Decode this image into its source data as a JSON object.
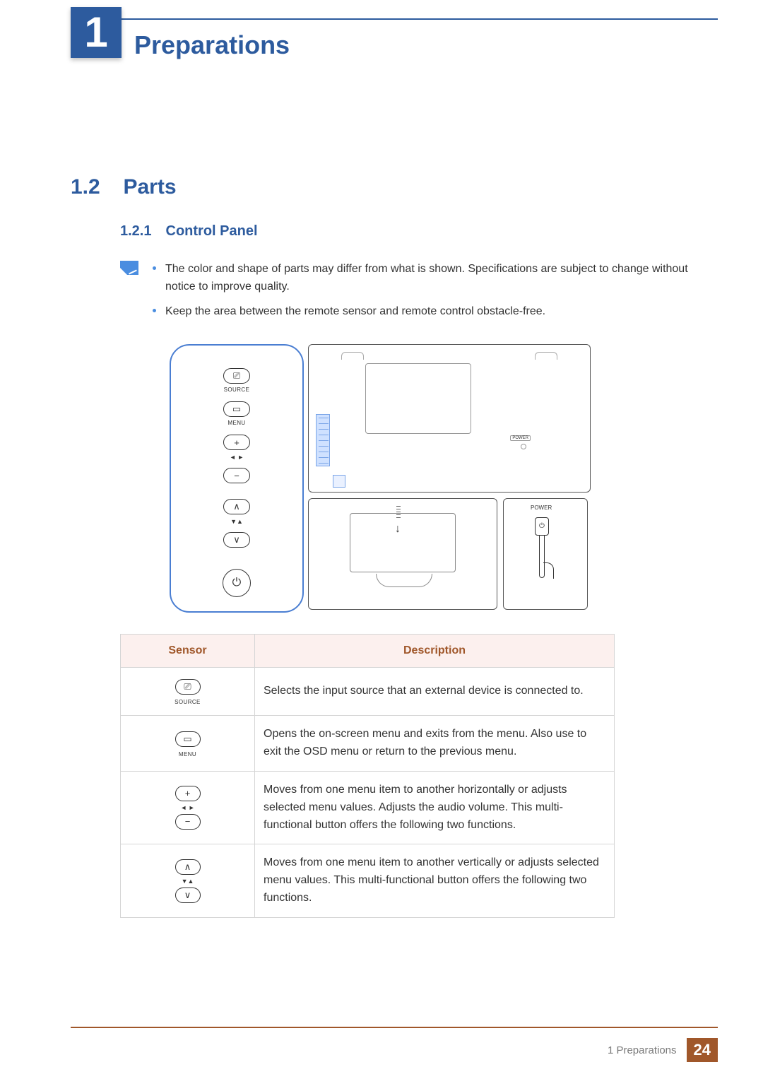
{
  "chapter": {
    "number": "1",
    "title": "Preparations"
  },
  "section": {
    "number": "1.2",
    "title": "Parts"
  },
  "subsection": {
    "number": "1.2.1",
    "title": "Control Panel"
  },
  "notes": {
    "items": [
      "The color and shape of parts may differ from what is shown. Specifications are subject to change without notice to improve quality.",
      "Keep the area between the remote sensor and remote control obstacle-free."
    ]
  },
  "illustration": {
    "panel_labels": {
      "source": "SOURCE",
      "menu": "MENU",
      "lr": "◄ ►",
      "ud": "▼▲"
    },
    "monitor_power_tag": "POWER",
    "detail_power_label": "POWER"
  },
  "table": {
    "headers": {
      "sensor": "Sensor",
      "description": "Description"
    },
    "rows": [
      {
        "sensor": {
          "icon": "source-icon",
          "label": "SOURCE"
        },
        "desc": "Selects the input source that an external device is connected to."
      },
      {
        "sensor": {
          "icon": "menu-icon",
          "label": "MENU"
        },
        "desc": "Opens the on-screen menu and exits from the menu. Also use to exit the OSD menu or return to the previous menu."
      },
      {
        "sensor": {
          "icon": "plus-minus-icon",
          "label": "◄ ►"
        },
        "desc": "Moves from one menu item to another horizontally or adjusts selected menu values. Adjusts the audio volume. This multi-functional button offers the following two functions."
      },
      {
        "sensor": {
          "icon": "up-down-icon",
          "label": "▼▲"
        },
        "desc": "Moves from one menu item to another vertically or adjusts selected menu values. This multi-functional button offers the following two functions."
      }
    ]
  },
  "footer": {
    "chapter_ref": "1 Preparations",
    "page": "24"
  },
  "glyphs": {
    "source": "⎚",
    "menu": "▭",
    "plus": "+",
    "minus": "−",
    "up": "∧",
    "down": "∨",
    "power": "⏻"
  }
}
